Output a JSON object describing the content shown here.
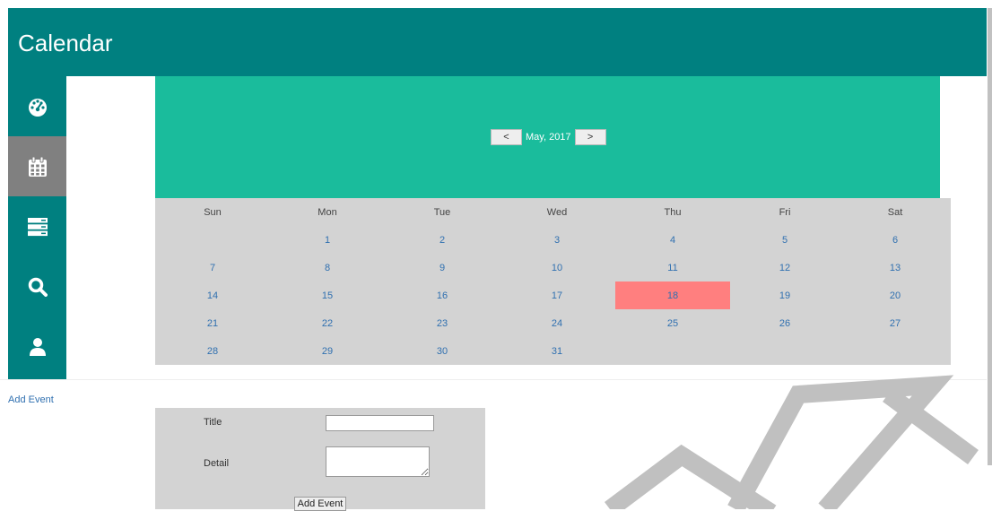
{
  "header": {
    "title": "Calendar"
  },
  "sidebar": {
    "items": [
      {
        "icon": "dashboard-icon",
        "active": false
      },
      {
        "icon": "calendar-icon",
        "active": true
      },
      {
        "icon": "server-icon",
        "active": false
      },
      {
        "icon": "search-icon",
        "active": false
      },
      {
        "icon": "user-icon",
        "active": false
      }
    ]
  },
  "calendar": {
    "prev_label": "<",
    "next_label": ">",
    "month_label": "May, 2017",
    "weekdays": [
      "Sun",
      "Mon",
      "Tue",
      "Wed",
      "Thu",
      "Fri",
      "Sat"
    ],
    "weeks": [
      [
        "",
        "1",
        "2",
        "3",
        "4",
        "5",
        "6"
      ],
      [
        "7",
        "8",
        "9",
        "10",
        "11",
        "12",
        "13"
      ],
      [
        "14",
        "15",
        "16",
        "17",
        "18",
        "19",
        "20"
      ],
      [
        "21",
        "22",
        "23",
        "24",
        "25",
        "26",
        "27"
      ],
      [
        "28",
        "29",
        "30",
        "31",
        "",
        "",
        ""
      ]
    ],
    "highlighted_day": "18"
  },
  "add_event_link": "Add Event",
  "form": {
    "title_label": "Title",
    "title_value": "",
    "detail_label": "Detail",
    "detail_value": "",
    "submit_label": "Add Event"
  },
  "colors": {
    "header": "#008080",
    "banner": "#1abc9c",
    "grid": "#d3d3d3",
    "highlight": "#ff7f7f",
    "active_nav": "#808080",
    "link": "#3070b0"
  }
}
